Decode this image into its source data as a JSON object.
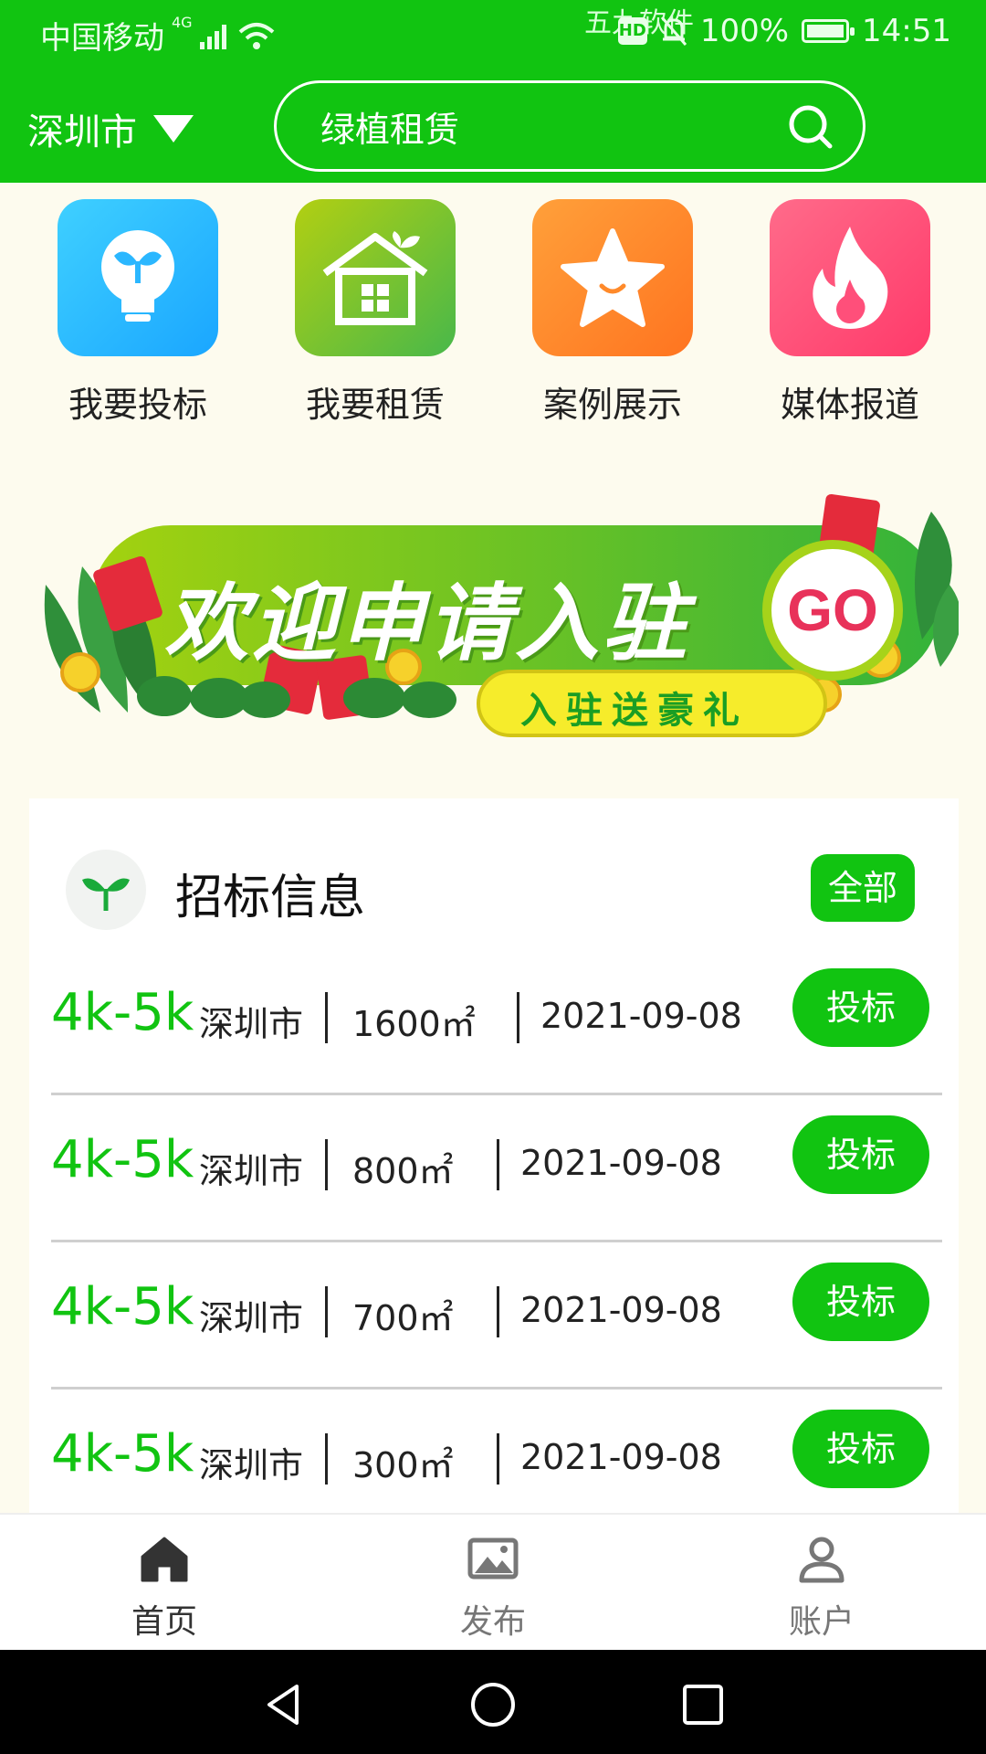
{
  "status_bar": {
    "carrier": "中国移动",
    "network": "4G",
    "watermark": "五九软件",
    "hd": "HD",
    "battery": "100%",
    "time": "14:51"
  },
  "header": {
    "city": "深圳市",
    "search_text": "绿植租赁"
  },
  "menu": [
    {
      "label": "我要投标",
      "icon": "bulb-sprout-icon",
      "color": "#1fb7ff"
    },
    {
      "label": "我要租赁",
      "icon": "house-icon",
      "color": "#7cc114"
    },
    {
      "label": "案例展示",
      "icon": "star-icon",
      "color": "#ff8a2a"
    },
    {
      "label": "媒体报道",
      "icon": "flame-icon",
      "color": "#ff4f7a"
    }
  ],
  "banner": {
    "title": "欢迎申请入驻",
    "go": "GO",
    "sub": "入驻送豪礼"
  },
  "tender": {
    "title": "招标信息",
    "all_label": "全部",
    "bid_label": "投标",
    "rows": [
      {
        "price": "4k-5k",
        "city": "深圳市",
        "area": "1600㎡",
        "date": "2021-09-08"
      },
      {
        "price": "4k-5k",
        "city": "深圳市",
        "area": "800㎡",
        "date": "2021-09-08"
      },
      {
        "price": "4k-5k",
        "city": "深圳市",
        "area": "700㎡",
        "date": "2021-09-08"
      },
      {
        "price": "4k-5k",
        "city": "深圳市",
        "area": "300㎡",
        "date": "2021-09-08"
      }
    ]
  },
  "tabbar": [
    {
      "label": "首页",
      "icon": "home-icon",
      "active": true
    },
    {
      "label": "发布",
      "icon": "image-icon",
      "active": false
    },
    {
      "label": "账户",
      "icon": "person-icon",
      "active": false
    }
  ],
  "colors": {
    "accent": "#11c411",
    "background": "#fdfbee"
  }
}
